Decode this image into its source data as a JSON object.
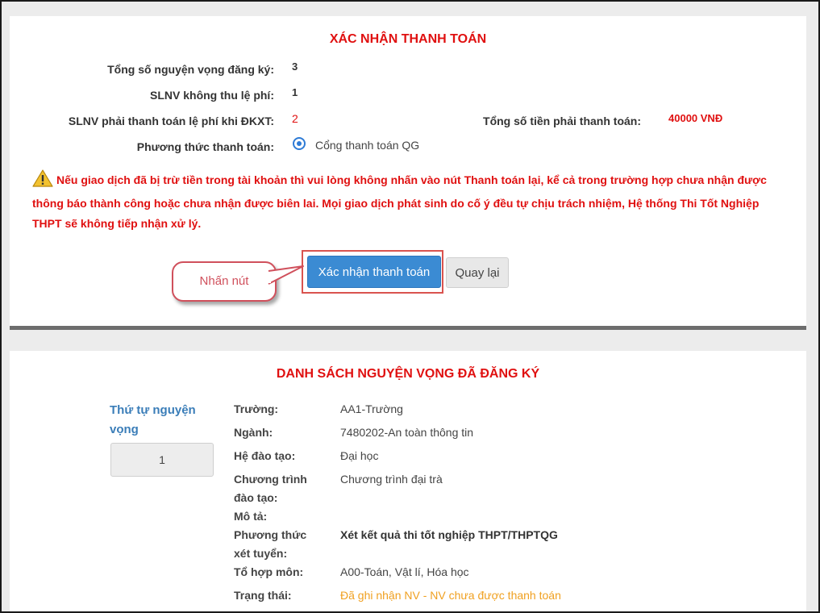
{
  "payment": {
    "title": "XÁC NHẬN THANH TOÁN",
    "total_label": "Tổng số nguyện vọng đăng ký:",
    "total_value": "3",
    "free_label": "SLNV không thu lệ phí:",
    "free_value": "1",
    "paid_label": "SLNV phải thanh toán lệ phí khi ĐKXT:",
    "paid_value": "2",
    "amount_label": "Tổng số tiền phải thanh toán:",
    "amount_value": "40000 VNĐ",
    "method_label": "Phương thức thanh toán:",
    "method_option": "Cổng thanh toán QG",
    "warning": "Nếu giao dịch đã bị trừ tiền trong tài khoản thì vui lòng không nhấn vào nút Thanh toán lại, kể cả trong trường hợp chưa nhận được thông báo thành công hoặc chưa nhận được biên lai. Mọi giao dịch phát sinh do cố ý đều tự chịu trách nhiệm, Hệ thống Thi Tốt Nghiệp THPT sẽ không tiếp nhận xử lý.",
    "confirm_button": "Xác nhận thanh toán",
    "back_button": "Quay lại",
    "callout": "Nhấn nút"
  },
  "list": {
    "title": "DANH SÁCH NGUYỆN VỌNG ĐÃ ĐĂNG KÝ",
    "order_label": "Thứ tự nguyện vọng",
    "order_value": "1",
    "school_label": "Trường:",
    "school_value": "AA1-Trường",
    "major_label": "Ngành:",
    "major_value": "7480202-An toàn thông tin",
    "level_label": "Hệ đào tạo:",
    "level_value": "Đại học",
    "program_label": "Chương trình đào tạo:",
    "program_value": "Chương trình đại trà",
    "desc_label": "Mô tả:",
    "method_label": "Phương thức xét tuyển:",
    "method_value": "Xét kết quả thi tốt nghiệp THPT/THPTQG",
    "combo_label": "Tổ hợp môn:",
    "combo_value": "A00-Toán, Vật lí, Hóa học",
    "status_label": "Trạng thái:",
    "status_value": "Đã ghi nhận NV - NV chưa được thanh toán"
  },
  "colors": {
    "accent_red": "#e01010",
    "primary_blue": "#3b8bd3",
    "status_orange": "#f0a020",
    "label_blue": "#3a7db8"
  }
}
